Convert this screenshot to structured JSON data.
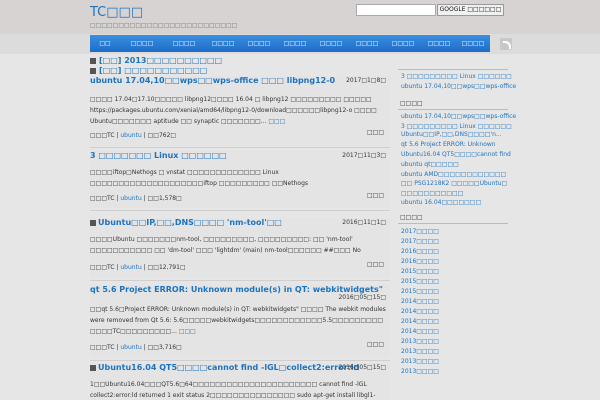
{
  "header": {
    "title": "TC□□□",
    "description": "□□□□□□□□□□□□□□□□□□□□□□□□□□",
    "search_placeholder": "",
    "search_button": "GOOGLE □□□□□□"
  },
  "nav": [
    "□□",
    "□□□□",
    "□□□□",
    "□□□□",
    "□□□□",
    "□□□□",
    "□□□□",
    "□□□□",
    "□□□□",
    "□□□□",
    "□□□□"
  ],
  "sticky": [
    "[□□] 2013□□□□□□□□□□",
    "[□□] □□□□□□□□□□□"
  ],
  "posts": [
    {
      "title": "ubuntu 17.04,10□□wps□□wps-office □□□ libpng12-0",
      "date": "2017□1□8□",
      "body": "□□□□ 17.04□17.10□□□□□ libpng12□□□□ 16.04 □ libpng12 □□□□□□□□□ □□□□□ https://packages.ubuntu.com/xenial/amd64/libpng12-0/download□□□□□□libpng12-o □□□□ Ubuntu□□□□□□□ aptitude □□ synaptic □□□□□□□...",
      "more": "□□□",
      "meta_author": "□□□TC",
      "meta_cat": "ubuntu",
      "meta_views": "□□762□",
      "comment": "□□□"
    },
    {
      "title": "3 □□□□□□□ Linux □□□□□□",
      "date": "2017□11□3□",
      "body": "□□□□iftop□Nethogs □ vnstat □□□□□□□□□□□□□ Linux □□□□□□□□□□□□□□□□□□□□iftop □□□□□□□□□ □□Nethogs □□□□□□□□□□□□□□□□vnstat □□□□□□□□□□□□□□□□□□□□□□...",
      "more": "□□□",
      "meta_author": "□□□TC",
      "meta_cat": "ubuntu",
      "meta_views": "□□1,578□",
      "comment": "□□□"
    },
    {
      "title": "Ubuntu□□IP,□□,DNS□□□□ 'nm-tool'□□",
      "date": "2016□11□1□",
      "body": "□□□□Ubuntu □□□□□□□nm-tool, □□□□□□□□□, □□□□□□□□□: □□ 'nm-tool' □□□□□□□□□□□ □□ 'dm-tool' □□□ 'lightdm' (main) nm-tool□□□□□□ ##□□□ No command 'nm-tool'□...",
      "more": "□□□",
      "meta_author": "□□□TC",
      "meta_cat": "ubuntu",
      "meta_views": "□□12,791□",
      "comment": "□□□"
    },
    {
      "title": "qt 5.6 Project ERROR: Unknown module(s) in QT: webkitwidgets\"",
      "date": "2016□05□15□",
      "body": "□□qt 5.6□Project ERROR: Unknown module(s) in QT: webkitwidgets\" □□□□ The webkit modules were removed from Qt 5.6: 5.6□□□□□webkitwidgets□□□□□□□□□□□□5.5□□□□□□□□□ □□□□TC□□□□□□□□□...",
      "more": "□□□",
      "meta_author": "□□□TC",
      "meta_cat": "ubuntu",
      "meta_views": "□□3,716□",
      "comment": "□□□"
    },
    {
      "title": "Ubuntu16.04 QT5□□□□cannot find -lGL□collect2:error:ld",
      "date": "2016□05□15□",
      "body": "1□□Ubuntu16.04□□□QT5.6□64□□□□□□□□□□□□□□□□□□□□□□ cannot find -lGL collect2:error:ld returned 1 exit status 2□□□□□□□□□□□□□□□ sudo apt-get install libgl1-mesa-dev",
      "more": "",
      "meta_author": "",
      "meta_cat": "",
      "meta_views": "",
      "comment": ""
    }
  ],
  "sidebar": {
    "recent_title": "",
    "recent": [
      "3 □□□□□□□□□ Linux □□□□□□",
      "ubuntu 17.04,10□□wps□□wps-office"
    ],
    "popular_title": "□□□□",
    "popular": [
      "ubuntu 17.04,10□□wps□□wps-office",
      "3 □□□□□□□□□ Linux □□□□□□",
      "Ubuntu□□IP,□□,DNS□□□□'n...",
      "qt 5.6 Project ERROR: Unknown",
      "Ubuntu16.04 QT5□□□□cannot find",
      "ubuntu qt□□□□□",
      "ubuntu AMD□□□□□□□□□□□□",
      "□□ PSG1218K2 □□□□□Ubuntu□",
      "□□□□□□□□□□□",
      "ubuntu 16.04□□□□□□□"
    ],
    "archive_title": "□□□□",
    "archive": [
      "2017□□□□",
      "2017□□□□",
      "2016□□□□",
      "2016□□□□",
      "2015□□□□",
      "2015□□□□",
      "2015□□□□",
      "2014□□□□",
      "2014□□□□",
      "2014□□□□",
      "2014□□□□",
      "2013□□□□",
      "2013□□□□",
      "2013□□□□",
      "2013□□□□"
    ]
  }
}
